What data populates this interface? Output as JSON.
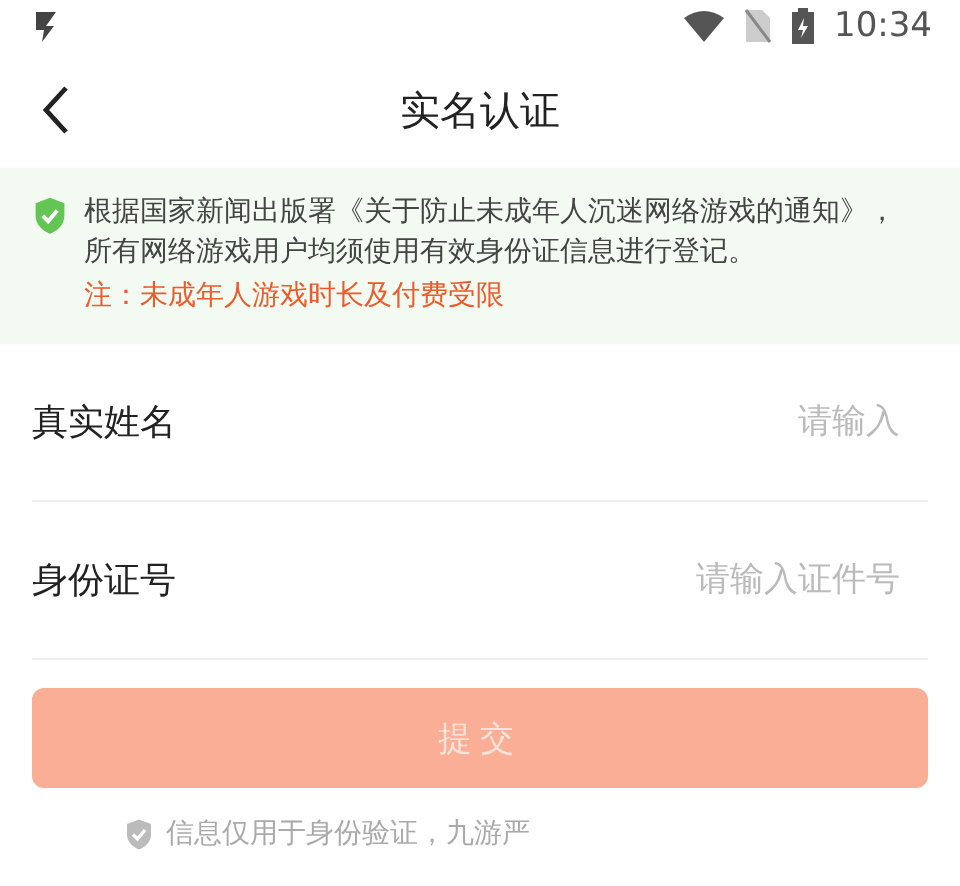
{
  "status_bar": {
    "time": "10:34"
  },
  "header": {
    "title": "实名认证"
  },
  "notice": {
    "text": "根据国家新闻出版署《关于防止未成年人沉迷网络游戏的通知》，所有网络游戏用户均须使用有效身份证信息进行登记。",
    "warning": "注：未成年人游戏时长及付费受限"
  },
  "fields": [
    {
      "label": "真实姓名",
      "placeholder": "请输入"
    },
    {
      "label": "身份证号",
      "placeholder": "请输入证件号"
    }
  ],
  "submit": {
    "label": "提交",
    "disabled": true
  },
  "footer": {
    "text": "信息仅用于身份验证，九游严"
  }
}
